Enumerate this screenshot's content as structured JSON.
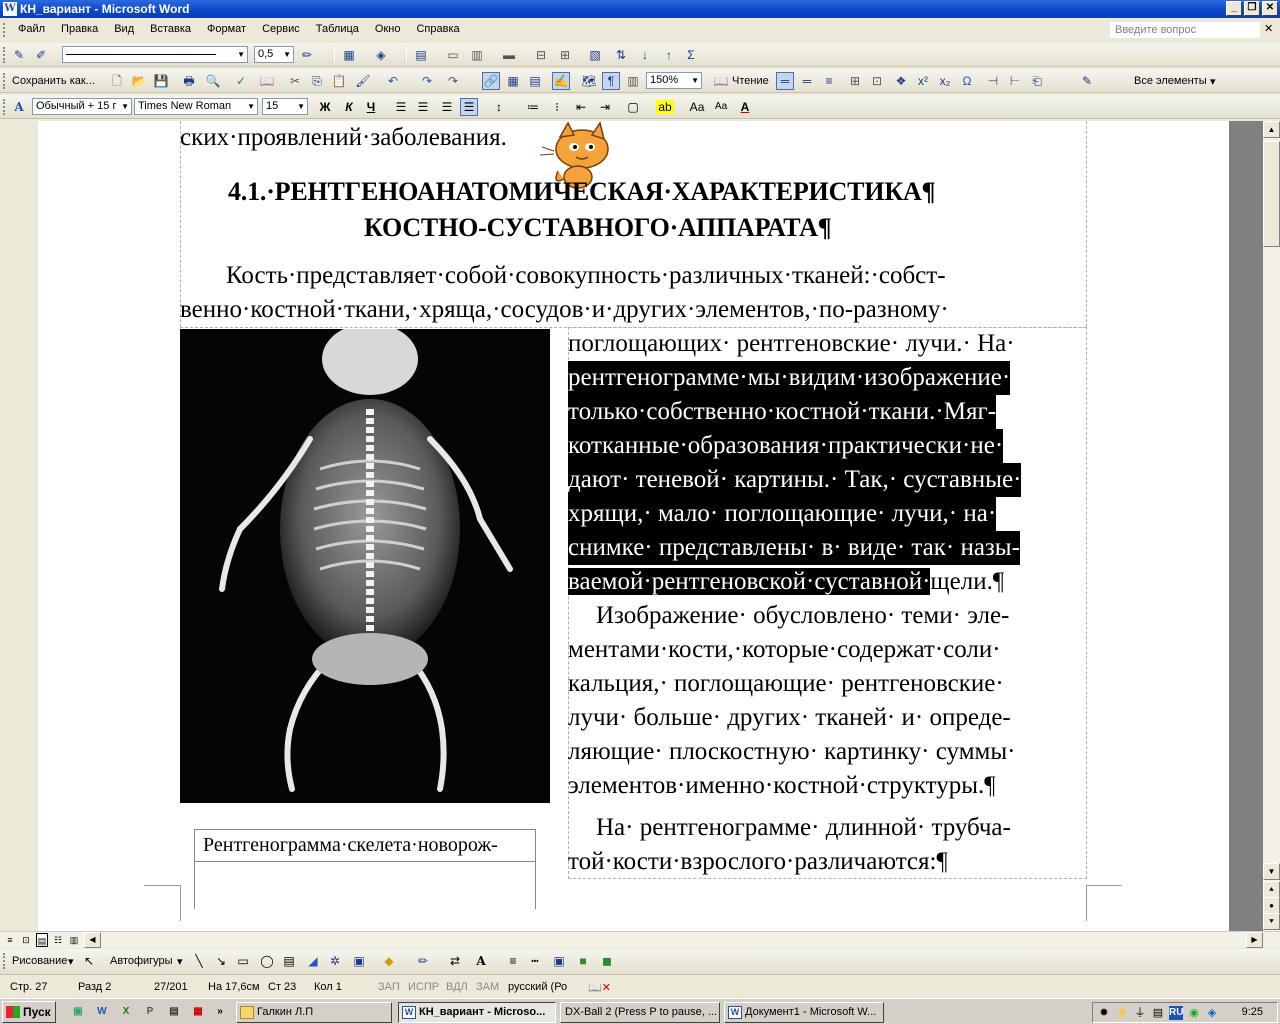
{
  "window": {
    "title": "КН_вариант - Microsoft Word"
  },
  "menu": {
    "items": [
      "Файл",
      "Правка",
      "Вид",
      "Вставка",
      "Формат",
      "Сервис",
      "Таблица",
      "Окно",
      "Справка"
    ],
    "ask_placeholder": "Введите вопрос"
  },
  "toolbar_draw_lines": {
    "line_width": "0,5"
  },
  "toolbar_standard": {
    "save_as_label": "Сохранить как...",
    "zoom": "150%",
    "reading_label": "Чтение",
    "all_elements": "Все элементы"
  },
  "toolbar_format": {
    "style": "Обычный + 15 г",
    "font": "Times New Roman",
    "size": "15"
  },
  "document": {
    "line0": "ских·проявлений·заболевания.",
    "heading1": "4.1.·РЕНТГЕНОАНАТОМИЧЕСКАЯ·ХАРАКТЕРИСТИКА¶",
    "heading2": "КОСТНО-СУСТАВНОГО·АППАРАТА¶",
    "para1_l1": "Кость·представляет·собой·совокупность·различных·тканей:·собст-",
    "para1_l2": "венно·костной·ткани,·хряща,·сосудов·и·других·элементов,·по-разному·",
    "col_l1": "поглощающих· рентгеновские· лучи.· На·",
    "col_l2": "рентгенограмме·мы·видим·изображение·",
    "col_l3": "только·собственно·костной·ткани.·Мяг-",
    "col_l4": "котканные·образования·практически·не·",
    "col_l5": "дают· теневой· картины.· Так,· суставные·",
    "col_l6": "хрящи,· мало· поглощающие· лучи,· на·",
    "col_l7": "снимке· представлены· в· виде· так· назы-",
    "col_l8a": "ваемой·рентгеновской·суставной·",
    "col_l8b": "щели.¶",
    "col_l9": "Изображение· обусловлено· теми· эле-",
    "col_l10": "ментами·кости,·которые·содержат·соли·",
    "col_l11": "кальция,· поглощающие· рентгеновские·",
    "col_l12": "лучи· больше· других· тканей· и· опреде-",
    "col_l13": "ляющие· плоскостную· картинку· суммы·",
    "col_l14": "элементов·именно·костной·структуры.¶",
    "col_l15": "На· рентгенограмме· длинной· трубча-",
    "col_l16": "той·кости·взрослого·различаются:¶",
    "caption": "Рентгенограмма·скелета·новорож-"
  },
  "drawbar": {
    "drawing": "Рисование",
    "autoshapes": "Автофигуры"
  },
  "status": {
    "page": "Стр. 27",
    "section": "Разд 2",
    "pages": "27/201",
    "at": "На 17,6см",
    "line": "Ст 23",
    "col": "Кол 1",
    "rec": "ЗАП",
    "trk": "ИСПР",
    "ext": "ВДЛ",
    "ovr": "ЗАМ",
    "lang": "русский (Ро"
  },
  "taskbar": {
    "start": "Пуск",
    "tasks": [
      "Галкин Л.П",
      "КН_вариант - Microsо...",
      "DX-Ball 2  (Press P to pause, ...",
      "Документ1 - Microsoft W..."
    ],
    "lang": "RU",
    "clock": "9:25"
  },
  "icons": [
    "save-icon",
    "open-icon",
    "print-icon",
    "undo-icon",
    "redo-icon",
    "bold-icon",
    "italic-icon",
    "underline-icon",
    "align-left-icon",
    "align-center-icon",
    "align-right-icon",
    "justify-icon",
    "omega-icon",
    "cat-assistant-icon"
  ]
}
